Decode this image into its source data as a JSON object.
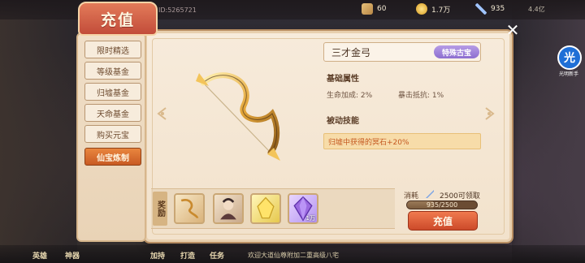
{
  "topbar": {
    "uid": "ID:5265721",
    "resources": [
      {
        "icon": "scroll-icon",
        "value": "60"
      },
      {
        "icon": "gold-ingot-icon",
        "value": "1.7万"
      },
      {
        "icon": "sword-icon",
        "value": "935"
      }
    ],
    "level": "4.4亿"
  },
  "dialog": {
    "title": "充值",
    "close_label": "✕"
  },
  "menu": {
    "items": [
      {
        "label": "限时精选",
        "active": false
      },
      {
        "label": "等级基金",
        "active": false
      },
      {
        "label": "归墟基金",
        "active": false
      },
      {
        "label": "天命基金",
        "active": false
      },
      {
        "label": "购买元宝",
        "active": false
      },
      {
        "label": "仙宝炼制",
        "active": true
      }
    ]
  },
  "item": {
    "name": "三才金弓",
    "rarity": "特殊古宝",
    "base_title": "基础属性",
    "attr1": "生命加成: 2%",
    "attr2": "暴击抵抗: 1%",
    "passive_title": "被动技能",
    "passive_text": "归墟中获得的冥石+20%"
  },
  "reward": {
    "label": "奖励",
    "slots": [
      {
        "icon": "golden-bow-icon",
        "qty": ""
      },
      {
        "icon": "warrior-portrait-icon",
        "qty": ""
      },
      {
        "icon": "yellow-crystal-icon",
        "qty": ""
      },
      {
        "icon": "purple-gem-icon",
        "qty": "1万"
      }
    ]
  },
  "purchase": {
    "consume_label": "消耗",
    "cost_text": "2500可领取",
    "progress_text": "935/2500",
    "progress_ratio": 0.374,
    "buy_label": "充值"
  },
  "bottom": {
    "marquee": "欢迎大道仙尊附加二重高级八宅",
    "menu": [
      "英雄",
      "神器",
      "加持",
      "打造",
      "任务"
    ]
  },
  "side_badge": {
    "label": "光",
    "sub": "光明新手"
  },
  "colors": {
    "accent": "#cc4a2a",
    "rare": "#8c6ed0",
    "panel": "#f7ebdb"
  }
}
